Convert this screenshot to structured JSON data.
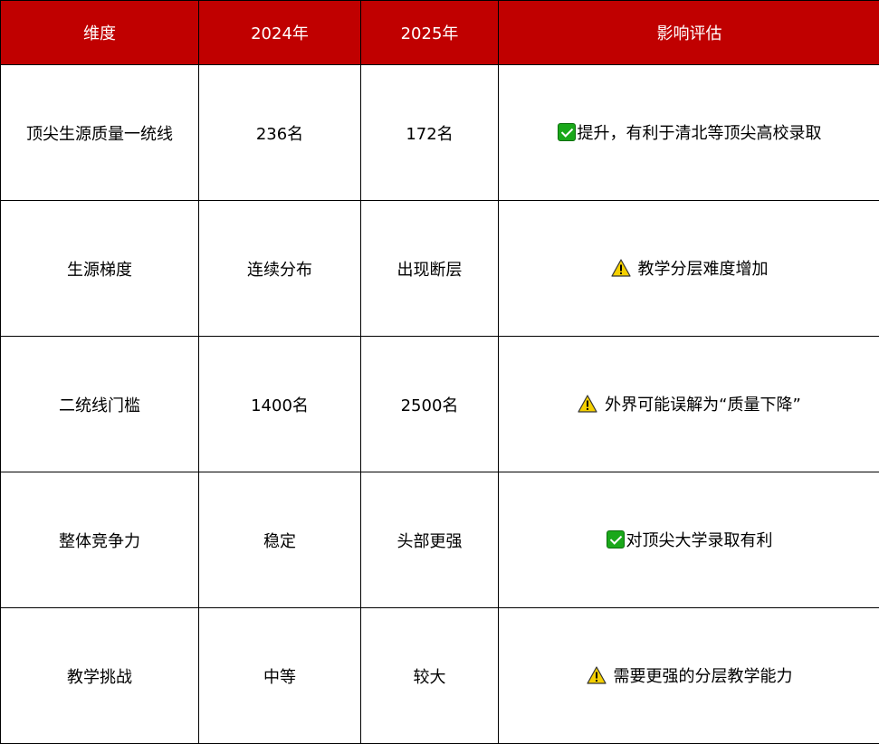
{
  "header": {
    "col1": "维度",
    "col2": "2024年",
    "col3": "2025年",
    "col4": "影响评估"
  },
  "rows": [
    {
      "dimension": "顶尖生源质量一统线",
      "y2024": "236名",
      "y2025": "172名",
      "icon": "check-icon",
      "impact": "提升，有利于清北等顶尖高校录取"
    },
    {
      "dimension": "生源梯度",
      "y2024": "连续分布",
      "y2025": "出现断层",
      "icon": "warning-icon",
      "impact": "教学分层难度增加"
    },
    {
      "dimension": "二统线门槛",
      "y2024": "1400名",
      "y2025": "2500名",
      "icon": "warning-icon",
      "impact": "外界可能误解为“质量下降”"
    },
    {
      "dimension": "整体竞争力",
      "y2024": "稳定",
      "y2025": "头部更强",
      "icon": "check-icon",
      "impact": "对顶尖大学录取有利"
    },
    {
      "dimension": "教学挑战",
      "y2024": "中等",
      "y2025": "较大",
      "icon": "warning-icon",
      "impact": "需要更强的分层教学能力"
    }
  ],
  "colors": {
    "header_bg": "#c00000",
    "header_text": "#ffffff",
    "check_green": "#1aa81a",
    "warning_yellow": "#f5d000"
  }
}
